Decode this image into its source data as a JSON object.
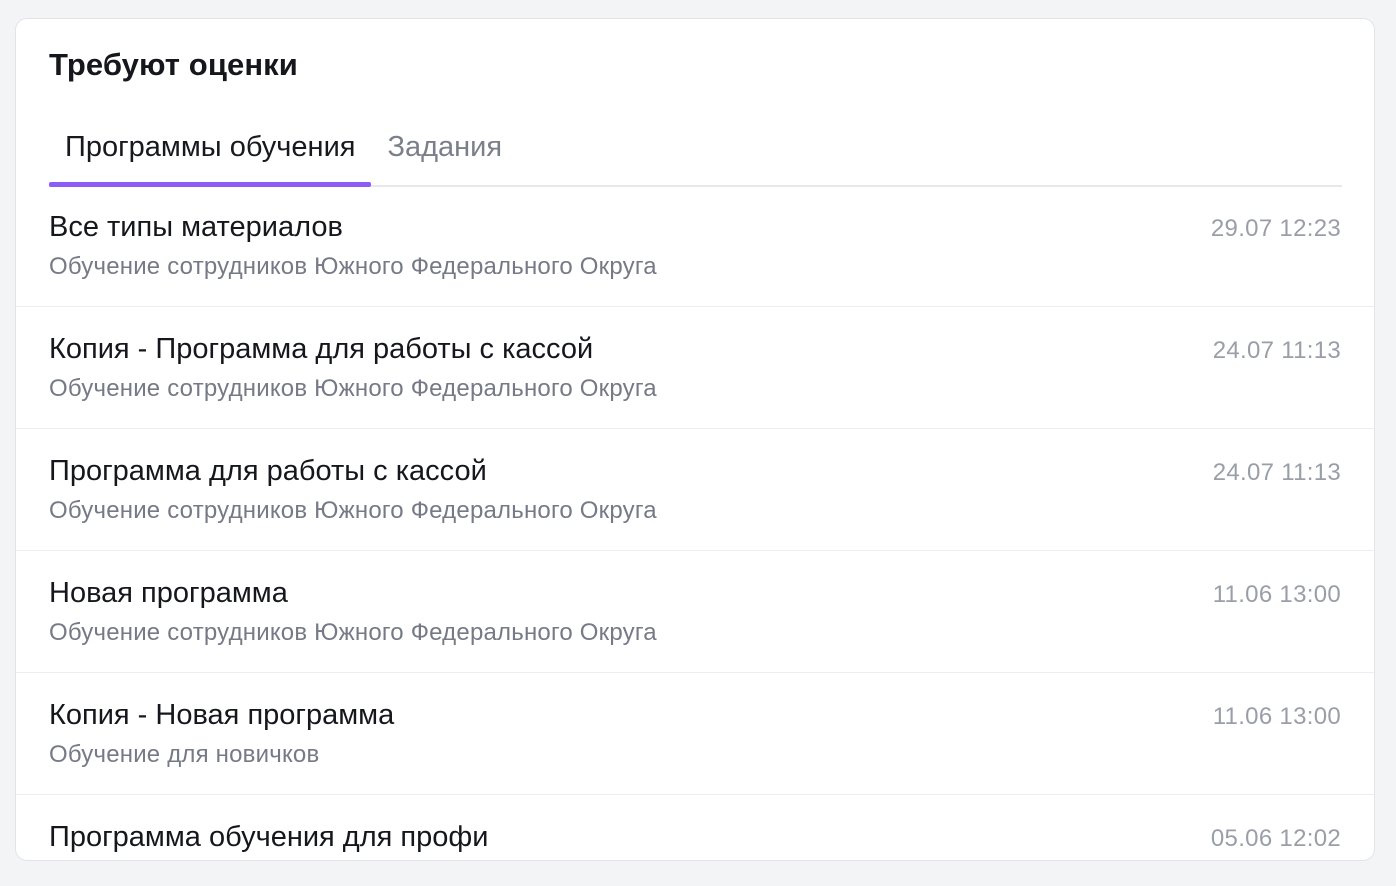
{
  "card": {
    "title": "Требуют оценки"
  },
  "tabs": [
    {
      "label": "Программы обучения",
      "active": true
    },
    {
      "label": "Задания",
      "active": false
    }
  ],
  "colors": {
    "accent": "#8b5cf6",
    "title_text": "#15171c",
    "subtitle_text": "#767a86",
    "date_text": "#9a9ea8"
  },
  "items": [
    {
      "title": "Все типы материалов",
      "subtitle": "Обучение сотрудников Южного Федерального Округа",
      "date": "29.07 12:23"
    },
    {
      "title": "Копия - Программа для работы с кассой",
      "subtitle": "Обучение сотрудников Южного Федерального Округа",
      "date": "24.07 11:13"
    },
    {
      "title": "Программа для работы с кассой",
      "subtitle": "Обучение сотрудников Южного Федерального Округа",
      "date": "24.07 11:13"
    },
    {
      "title": "Новая программа",
      "subtitle": "Обучение сотрудников Южного Федерального Округа",
      "date": "11.06 13:00"
    },
    {
      "title": "Копия - Новая программа",
      "subtitle": "Обучение для новичков",
      "date": "11.06 13:00"
    },
    {
      "title": "Программа обучения для профи",
      "subtitle": "",
      "date": "05.06 12:02"
    }
  ]
}
